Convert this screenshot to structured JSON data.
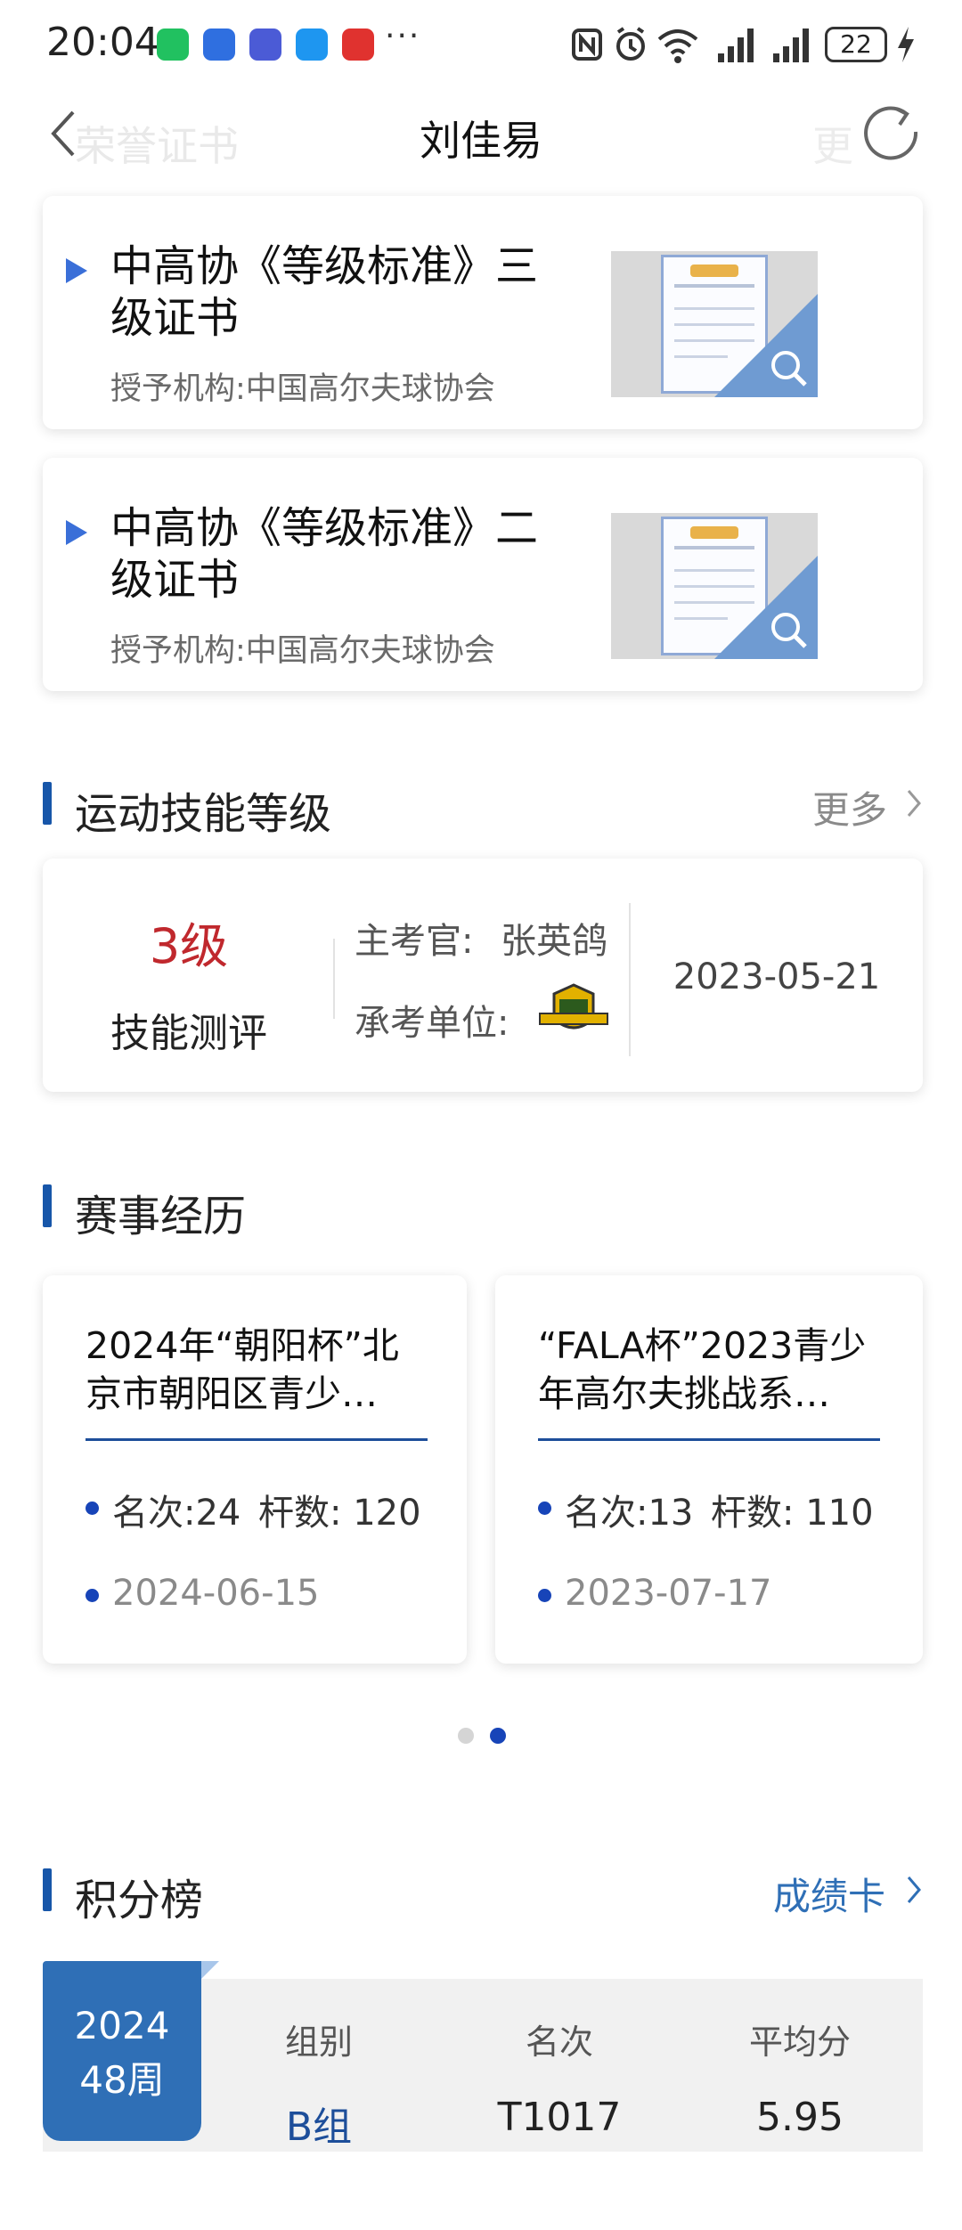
{
  "status_bar": {
    "time": "20:04",
    "overflow": "···",
    "battery": "22",
    "app_icons": [
      {
        "icon": "wechat-icon",
        "color": "#21c160"
      },
      {
        "icon": "app-blue-icon",
        "color": "#2f6fe0"
      },
      {
        "icon": "app-purple-icon",
        "color": "#4b5bd6"
      },
      {
        "icon": "message-icon",
        "color": "#1e96f0"
      },
      {
        "icon": "app-red-icon",
        "color": "#e0322f"
      }
    ]
  },
  "nav": {
    "title": "刘佳易",
    "ghost_left": "荣誉证书",
    "ghost_right": "更"
  },
  "certificates": [
    {
      "title": "中高协《等级标准》三级证书",
      "org": "授予机构:中国高尔夫球协会"
    },
    {
      "title": "中高协《等级标准》二级证书",
      "org": "授予机构:中国高尔夫球协会"
    }
  ],
  "skills": {
    "section_title": "运动技能等级",
    "more": "更多",
    "level": "3级",
    "level_label": "技能测评",
    "examiner_label": "主考官:",
    "examiner": "张英鸽",
    "unit_label": "承考单位:",
    "date": "2023-05-21"
  },
  "events": {
    "section_title": "赛事经历",
    "items": [
      {
        "title": "2024年“朝阳杯”北京市朝阳区青少…",
        "rank": "名次:24",
        "strokes": "杆数: 120",
        "date": "2024-06-15"
      },
      {
        "title": "“FALA杯”2023青少年高尔夫挑战系…",
        "rank": "名次:13",
        "strokes": "杆数: 110",
        "date": "2023-07-17"
      }
    ],
    "pager": {
      "count": 2,
      "active": 2
    }
  },
  "ranking": {
    "section_title": "积分榜",
    "link": "成绩卡",
    "week_year": "2024",
    "week": "48周",
    "headers": [
      "组别",
      "名次",
      "平均分"
    ],
    "values": [
      "B组",
      "T1017",
      "5.95"
    ]
  },
  "colors": {
    "accent": "#1756a9",
    "level_red": "#c0282d",
    "link_blue": "#2f6fb6"
  }
}
